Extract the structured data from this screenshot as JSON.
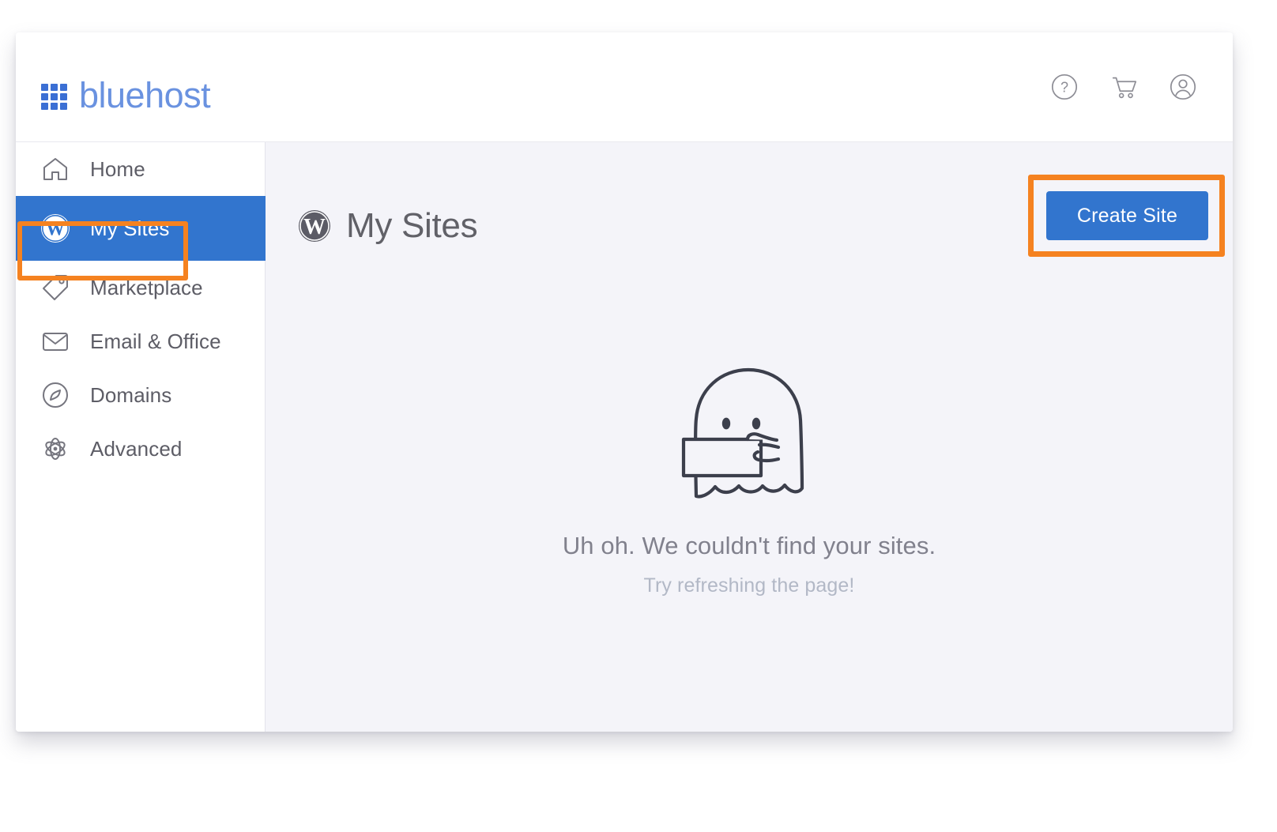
{
  "brand": {
    "name": "bluehost",
    "logo_icon": "grid-9-squares-icon",
    "logo_color": "#3b6fd4",
    "word_color": "#6a92e0"
  },
  "topbar": {
    "actions": [
      {
        "name": "help-icon",
        "label": "Help"
      },
      {
        "name": "cart-icon",
        "label": "Cart"
      },
      {
        "name": "account-icon",
        "label": "Account"
      }
    ]
  },
  "sidebar": {
    "items": [
      {
        "label": "Home",
        "icon": "home-icon",
        "active": false
      },
      {
        "label": "My Sites",
        "icon": "wordpress-icon",
        "active": true
      },
      {
        "label": "Marketplace",
        "icon": "tag-icon",
        "active": false
      },
      {
        "label": "Email & Office",
        "icon": "envelope-icon",
        "active": false
      },
      {
        "label": "Domains",
        "icon": "compass-icon",
        "active": false
      },
      {
        "label": "Advanced",
        "icon": "atom-icon",
        "active": false
      }
    ],
    "active_color": "#3275ce"
  },
  "main": {
    "title": "My Sites",
    "title_icon": "wordpress-icon",
    "create_site_label": "Create Site",
    "create_site_color": "#3275ce",
    "empty_state": {
      "illustration": "ghost-holding-sign-icon",
      "heading": "Uh oh. We couldn't find your sites.",
      "subtext": "Try refreshing the page!"
    }
  },
  "annotations": {
    "color": "#f58220",
    "boxes": [
      {
        "name": "annotation-box-my-sites",
        "target": "My Sites"
      },
      {
        "name": "annotation-box-create-site",
        "target": "Create Site"
      }
    ]
  }
}
